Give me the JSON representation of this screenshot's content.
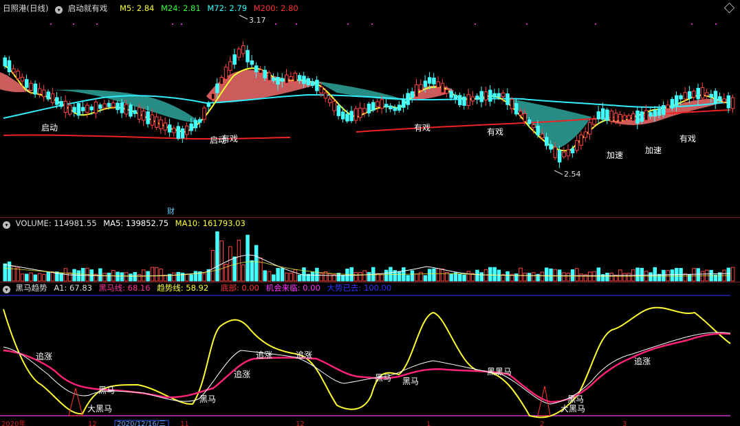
{
  "main": {
    "stock_title": "日照港(日线)",
    "indicator_name": "启动就有戏",
    "ma_labels": [
      {
        "text": "M5: 2.84",
        "color": "#ffff33"
      },
      {
        "text": "M24: 2.81",
        "color": "#33ff33"
      },
      {
        "text": "M72: 2.79",
        "color": "#33ffff"
      },
      {
        "text": "M200: 2.80",
        "color": "#ff3333"
      }
    ],
    "high_label": "3.17",
    "low_label": "2.54",
    "fin_marker": "财",
    "annotations": [
      "启动",
      "启动",
      "有戏",
      "有戏",
      "有戏",
      "加速",
      "加速",
      "有戏"
    ]
  },
  "volume": {
    "labels": [
      {
        "text": "VOLUME: 114981.55",
        "color": "#dddddd"
      },
      {
        "text": "MA5: 139852.75",
        "color": "#ffffff"
      },
      {
        "text": "MA10: 161793.03",
        "color": "#ffff33"
      }
    ]
  },
  "oscillator": {
    "title": "黑马趋势",
    "labels": [
      {
        "text": "A1: 67.83",
        "color": "#dddddd"
      },
      {
        "text": "黑马线: 68.16",
        "color": "#ff3399"
      },
      {
        "text": "趋势线: 58.92",
        "color": "#ffff33"
      },
      {
        "text": "底部: 0.00",
        "color": "#ff3333"
      },
      {
        "text": "机会来临: 0.00",
        "color": "#ff33ff"
      },
      {
        "text": "大势已去: 100.00",
        "color": "#3333ff"
      }
    ],
    "annotations": [
      "追涨",
      "黑马",
      "大黑马",
      "黑马",
      "追涨",
      "追涨",
      "追涨",
      "黑马",
      "黑马",
      "黑黑马",
      "黑马",
      "大黑马",
      "追涨"
    ]
  },
  "axis": {
    "labels": [
      "2020年",
      "12",
      "2020/12/16/三",
      "11",
      "12",
      "1",
      "2",
      "3"
    ]
  }
}
